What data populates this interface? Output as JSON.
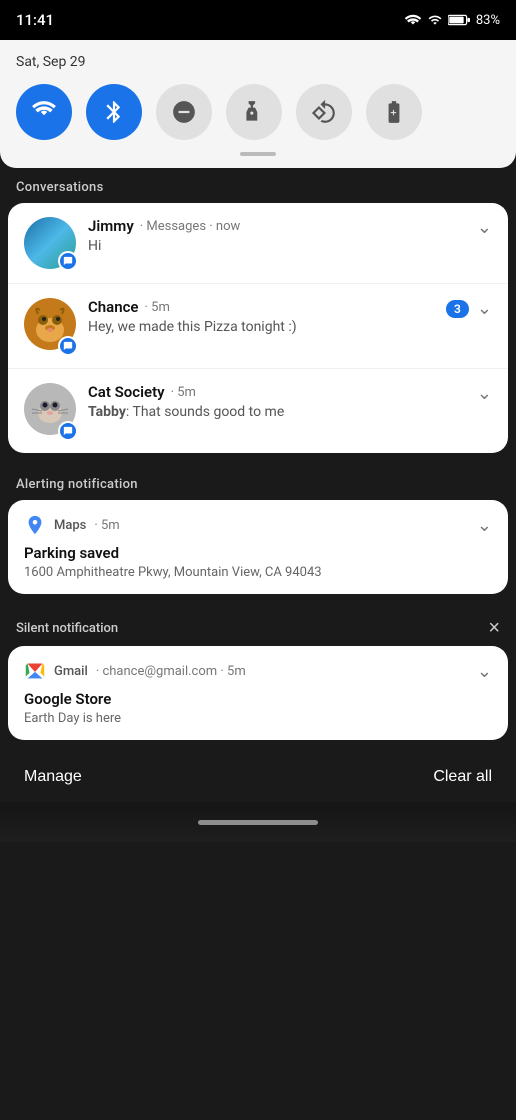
{
  "statusBar": {
    "time": "11:41",
    "battery": "83%"
  },
  "quickSettings": {
    "date": "Sat, Sep 29",
    "toggles": [
      {
        "id": "wifi",
        "label": "WiFi",
        "active": true
      },
      {
        "id": "bluetooth",
        "label": "Bluetooth",
        "active": true
      },
      {
        "id": "dnd",
        "label": "Do Not Disturb",
        "active": false
      },
      {
        "id": "flashlight",
        "label": "Flashlight",
        "active": false
      },
      {
        "id": "rotation",
        "label": "Auto Rotate",
        "active": false
      },
      {
        "id": "battery",
        "label": "Battery Saver",
        "active": false
      }
    ]
  },
  "conversations": {
    "label": "Conversations",
    "items": [
      {
        "id": "jimmy",
        "name": "Jimmy",
        "app": "Messages",
        "time": "now",
        "message": "Hi",
        "badge": null
      },
      {
        "id": "chance",
        "name": "Chance",
        "app": "Messages",
        "time": "5m",
        "message": "Hey, we made this Pizza tonight :)",
        "badge": "3"
      },
      {
        "id": "cat-society",
        "name": "Cat Society",
        "app": "Messages",
        "time": "5m",
        "sender": "Tabby",
        "message": "That sounds good to me",
        "badge": null
      }
    ]
  },
  "alertingNotification": {
    "label": "Alerting notification",
    "app": "Maps",
    "time": "5m",
    "title": "Parking saved",
    "body": "1600 Amphitheatre Pkwy, Mountain View, CA 94043"
  },
  "silentNotification": {
    "label": "Silent notification",
    "closeBtn": "×",
    "app": "Gmail",
    "email": "chance@gmail.com",
    "time": "5m",
    "title": "Google Store",
    "body": "Earth Day is here"
  },
  "bottomBar": {
    "manageLabel": "Manage",
    "clearAllLabel": "Clear all"
  }
}
